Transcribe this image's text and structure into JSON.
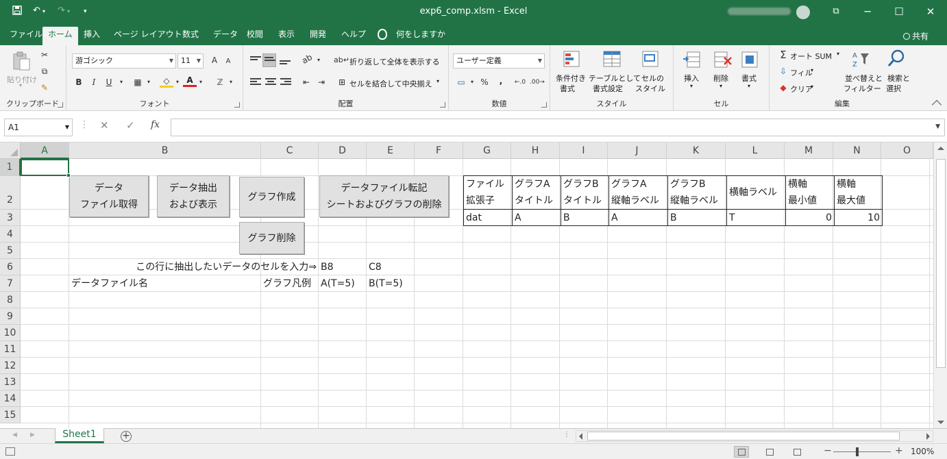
{
  "window": {
    "title": "exp6_comp.xlsm  -  Excel",
    "controls": {
      "restore": "⧉",
      "minimize": "─",
      "maximize": "☐",
      "close": "✕"
    }
  },
  "quick_access": {
    "save_icon": "save-icon",
    "undo_icon": "undo-icon",
    "redo_icon": "redo-icon",
    "customize_icon": "customize-icon"
  },
  "tabs": [
    "ファイル",
    "ホーム",
    "挿入",
    "ページ レイアウト",
    "数式",
    "データ",
    "校閲",
    "表示",
    "開発",
    "ヘルプ"
  ],
  "active_tab": "ホーム",
  "tell_me": "何をしますか",
  "share": "共有",
  "ribbon": {
    "clipboard": {
      "paste": "貼り付け",
      "group": "クリップボード"
    },
    "font": {
      "name": "游ゴシック",
      "size": "11",
      "bold": "B",
      "italic": "I",
      "underline": "U",
      "grow": "A",
      "shrink": "A",
      "group": "フォント"
    },
    "alignment": {
      "wrap": "折り返して全体を表示する",
      "merge": "セルを結合して中央揃え",
      "group": "配置"
    },
    "number": {
      "format": "ユーザー定義",
      "percent": "%",
      "comma": ",",
      "group": "数値"
    },
    "styles": {
      "conditional_l1": "条件付き",
      "conditional_l2": "書式",
      "table_l1": "テーブルとして",
      "table_l2": "書式設定",
      "cell_l1": "セルの",
      "cell_l2": "スタイル",
      "group": "スタイル"
    },
    "cells": {
      "insert": "挿入",
      "delete": "削除",
      "format": "書式",
      "group": "セル"
    },
    "editing": {
      "autosum": "オート SUM",
      "fill": "フィル",
      "clear": "クリア",
      "sort_l1": "並べ替えと",
      "sort_l2": "フィルター",
      "find_l1": "検索と",
      "find_l2": "選択",
      "group": "編集"
    }
  },
  "formula_bar": {
    "namebox": "A1",
    "fx": "fx",
    "value": ""
  },
  "columns": [
    "A",
    "B",
    "C",
    "D",
    "E",
    "F",
    "G",
    "H",
    "I",
    "J",
    "K",
    "L",
    "M",
    "N",
    "O"
  ],
  "rows": [
    "1",
    "2",
    "3",
    "4",
    "5",
    "6",
    "7",
    "8",
    "9",
    "10",
    "11",
    "12",
    "13",
    "14",
    "15"
  ],
  "selected_cell": "A1",
  "buttons": {
    "get_data_l1": "データ",
    "get_data_l2": "ファイル取得",
    "extract_l1": "データ抽出",
    "extract_l2": "および表示",
    "make_graph": "グラフ作成",
    "delete_graph": "グラフ削除",
    "transfer_l1": "データファイル転記",
    "transfer_l2": "シートおよびグラフの削除"
  },
  "cells": {
    "b6": "この行に抽出したいデータのセルを入力⇒",
    "d6": "B8",
    "e6": "C8",
    "b7": "データファイル名",
    "c7": "グラフ凡例",
    "d7": "A(T=5)",
    "e7": "B(T=5)"
  },
  "config_table": {
    "header": [
      [
        "ファイル",
        "拡張子"
      ],
      [
        "グラフA",
        "タイトル"
      ],
      [
        "グラフB",
        "タイトル"
      ],
      [
        "グラフA",
        "縦軸ラベル"
      ],
      [
        "グラフB",
        "縦軸ラベル"
      ],
      [
        "横軸ラベル"
      ],
      [
        "横軸",
        "最小値"
      ],
      [
        "横軸",
        "最大値"
      ]
    ],
    "values": [
      "dat",
      "A",
      "B",
      "A",
      "B",
      "T",
      "0",
      "10"
    ]
  },
  "sheets": [
    "Sheet1"
  ],
  "status": {
    "zoom": "100%",
    "minus": "−",
    "plus": "+"
  }
}
